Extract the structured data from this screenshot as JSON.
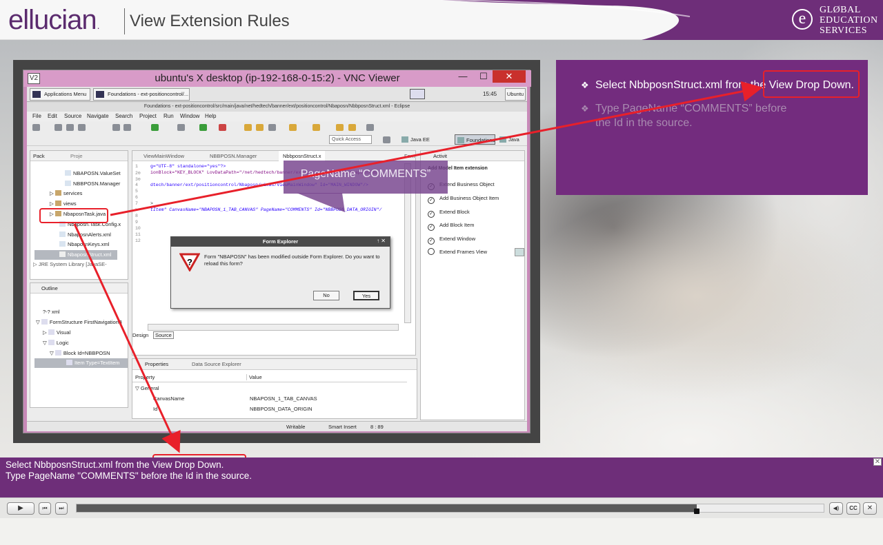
{
  "header": {
    "logo_text": "ellucian",
    "logo_dot": ".",
    "title": "View Extension Rules",
    "badge_letter": "e",
    "badge_lines": [
      "GLØBAL",
      "EDUCATION",
      "SERVICES"
    ]
  },
  "vnc": {
    "title": "ubuntu's X desktop (ip-192-168-0-15:2) - VNC Viewer",
    "logo": "V2",
    "min_glyph": "—",
    "max_glyph": "☐",
    "close_glyph": "✕"
  },
  "desktop": {
    "apps_menu": "Applications Menu",
    "task_foundations": "Foundations - ext-positioncontrol/...",
    "clock": "15:45",
    "user": "Ubuntu",
    "eclipse_title": "Foundations - ext-positioncontrol/src/main/java/net/hedtech/banner/ext/positioncontrol/Nbaposn/NbbposnStruct.xml - Eclipse",
    "menus": [
      "File",
      "Edit",
      "Source",
      "Navigate",
      "Search",
      "Project",
      "Run",
      "Window",
      "Help"
    ],
    "quick_access": "Quick Access",
    "perspectives": [
      "Java EE",
      "Foundations",
      "Java"
    ],
    "package_tabs": [
      "Pack",
      "Proje"
    ],
    "tree": [
      "NBAPOSN.ValueSet",
      "NBBPOSN.Manager",
      "services",
      "views",
      "NbaposnTask.java",
      "Nbaposn.Task.Config.x",
      "NbaposnAlerts.xml",
      "NbaposnKeys.xml",
      "NbaposnStruct.xml",
      "JRE System Library [JavaSE-"
    ],
    "editor_tabs": [
      "ViewMainWindow",
      "NBBPOSN.Manager",
      "NbbposnStruct.x",
      "Form"
    ],
    "code_lines": [
      "g=\"UTF-8\" standalone=\"yes\"?>",
      "ionBlock=\"KEY_BLOCK\" LovDataPath=\"/net/hedtech/banner/ext/positioncontrol/Nbaposn/Nba",
      "",
      "dtech/banner/ext/positioncontrol/Nbaposn/views/ViewMainWindow\" Id=\"MAIN_WINDOW\"/>",
      "",
      "",
      ">",
      "tItem\" CanvasName=\"NBAPOSN_1_TAB_CANVAS\" PageName=\"COMMENTS\" Id=\"NBBPOSN_DATA_ORIGIN\"/"
    ],
    "line_numbers": [
      "1",
      "2⊖",
      "3⊖",
      "4",
      "5",
      "6",
      "7",
      ">",
      "8",
      "9",
      "10",
      "11",
      "12"
    ],
    "editor_bottom_tabs": [
      "Design",
      "Source"
    ],
    "activity_tab": "Activit",
    "activity_heading": "Add Model Item extension",
    "activity_items": [
      "Extend Business Object",
      "Add Business Object Item",
      "Extend Block",
      "Add Block Item",
      "Extend Window",
      "Extend Frames View"
    ],
    "outline_tab": "Outline",
    "outline_rows": [
      "?-? xml",
      "FormStructure FirstNavigationB",
      "Visual",
      "Logic",
      "Block Id=NBBPOSN",
      "Item Type=TextItem"
    ],
    "properties_tabs": [
      "Properties",
      "Data Source Explorer"
    ],
    "prop_headers": [
      "Property",
      "Value"
    ],
    "prop_rows": [
      {
        "name": "General",
        "value": ""
      },
      {
        "name": "CanvasName",
        "value": "NBAPOSN_1_TAB_CANVAS"
      },
      {
        "name": "Id",
        "value": "NBBPOSN_DATA_ORIGIN"
      }
    ],
    "status_items": [
      "Writable",
      "Smart Insert",
      "8 : 89"
    ]
  },
  "dialog": {
    "title": "Form Explorer",
    "message": "Form \"NBAPOSN\" has been modified outside Form Explorer. Do you want to reload this form?",
    "no_label": "No",
    "yes_label": "Yes",
    "title_btns": "↑ ✕"
  },
  "callout": {
    "text": "PageName “COMMENTS”"
  },
  "instructions": {
    "step1": "Select NbbposnStruct.xml from the View Drop Down.",
    "step2": "Type PageName “COMMENTS” before the Id in the source.",
    "bullet": "❖"
  },
  "caption": {
    "line1": "Select NbbposnStruct.xml from the View Drop Down.",
    "line2": "Type PageName \"COMMENTS\" before the Id in the source.",
    "close_glyph": "✕"
  },
  "player": {
    "play_glyph": "▶",
    "prev_glyph": "⏮",
    "next_glyph": "⏭",
    "volume_glyph": "◀)",
    "cc_label": "CC",
    "close_glyph": "✕",
    "progress": 0.83
  },
  "colors": {
    "brand_purple": "#6e2e79",
    "highlight_red": "#e8202a"
  }
}
